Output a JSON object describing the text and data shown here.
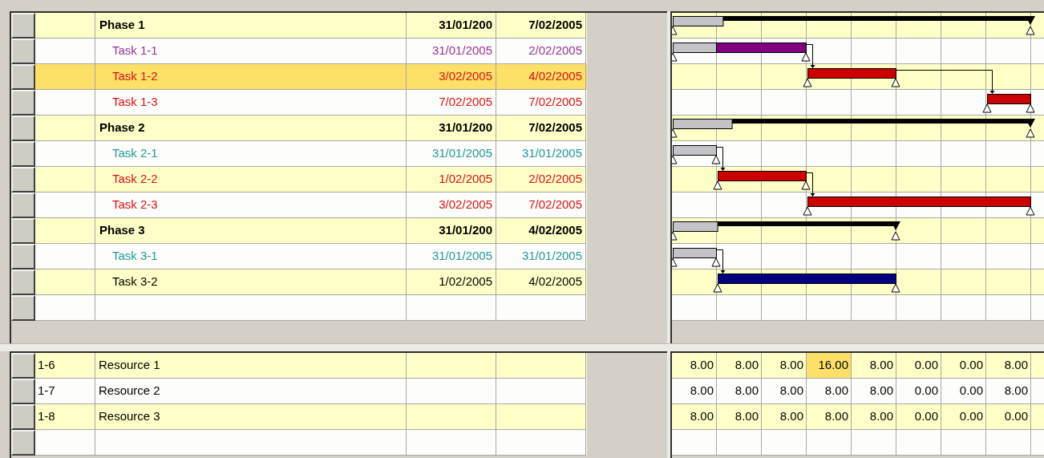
{
  "tasks": [
    {
      "kind": "phase",
      "name": "Phase 1",
      "start": "31/01/200",
      "finish": "7/02/2005",
      "selected": false,
      "level": 0.14
    },
    {
      "kind": "task",
      "name": "Task 1-1",
      "start": "31/01/2005",
      "finish": "2/02/2005",
      "color": "#993399",
      "selected": false,
      "bar": {
        "color": "#800080",
        "complete": false,
        "level": 0.33
      }
    },
    {
      "kind": "task",
      "name": "Task 1-2",
      "start": "3/02/2005",
      "finish": "4/02/2005",
      "color": "#dd1111",
      "selected": true,
      "bar": {
        "color": "#cc0000",
        "complete": false
      }
    },
    {
      "kind": "task",
      "name": "Task 1-3",
      "start": "7/02/2005",
      "finish": "7/02/2005",
      "color": "#dd1111",
      "selected": false,
      "bar": {
        "color": "#cc0000",
        "complete": false
      }
    },
    {
      "kind": "phase",
      "name": "Phase 2",
      "start": "31/01/200",
      "finish": "7/02/2005",
      "selected": false,
      "level": 0.165
    },
    {
      "kind": "task",
      "name": "Task 2-1",
      "start": "31/01/2005",
      "finish": "31/01/2005",
      "color": "#229999",
      "selected": false,
      "bar": {
        "complete": true
      }
    },
    {
      "kind": "task",
      "name": "Task 2-2",
      "start": "1/02/2005",
      "finish": "2/02/2005",
      "color": "#dd1111",
      "selected": false,
      "bar": {
        "color": "#cc0000",
        "complete": false
      }
    },
    {
      "kind": "task",
      "name": "Task 2-3",
      "start": "3/02/2005",
      "finish": "7/02/2005",
      "color": "#dd1111",
      "selected": false,
      "bar": {
        "color": "#cc0000",
        "complete": false
      }
    },
    {
      "kind": "phase",
      "name": "Phase 3",
      "start": "31/01/200",
      "finish": "4/02/2005",
      "selected": false,
      "level": 0.2
    },
    {
      "kind": "task",
      "name": "Task 3-1",
      "start": "31/01/2005",
      "finish": "31/01/2005",
      "color": "#229999",
      "selected": false,
      "bar": {
        "complete": true
      }
    },
    {
      "kind": "task",
      "name": "Task 3-2",
      "start": "1/02/2005",
      "finish": "4/02/2005",
      "color": "#000000",
      "selected": false,
      "bar": {
        "color": "#000080",
        "complete": false
      }
    }
  ],
  "resources": [
    {
      "id": "1-6",
      "name": "Resource 1",
      "hours": [
        {
          "text": "8.00",
          "highlighted": false
        },
        {
          "text": "8.00",
          "highlighted": false
        },
        {
          "text": "8.00",
          "highlighted": false
        },
        {
          "text": "16.00",
          "highlighted": true
        },
        {
          "text": "8.00",
          "highlighted": false
        },
        {
          "text": "0.00",
          "highlighted": false
        },
        {
          "text": "0.00",
          "highlighted": false
        },
        {
          "text": "8.00",
          "highlighted": false
        }
      ]
    },
    {
      "id": "1-7",
      "name": "Resource 2",
      "hours": [
        {
          "text": "8.00",
          "highlighted": false
        },
        {
          "text": "8.00",
          "highlighted": false
        },
        {
          "text": "8.00",
          "highlighted": false
        },
        {
          "text": "8.00",
          "highlighted": false
        },
        {
          "text": "8.00",
          "highlighted": false
        },
        {
          "text": "0.00",
          "highlighted": false
        },
        {
          "text": "0.00",
          "highlighted": false
        },
        {
          "text": "8.00",
          "highlighted": false
        }
      ]
    },
    {
      "id": "1-8",
      "name": "Resource 3",
      "hours": [
        {
          "text": "8.00",
          "highlighted": false
        },
        {
          "text": "8.00",
          "highlighted": false
        },
        {
          "text": "8.00",
          "highlighted": false
        },
        {
          "text": "8.00",
          "highlighted": false
        },
        {
          "text": "8.00",
          "highlighted": false
        },
        {
          "text": "0.00",
          "highlighted": false
        },
        {
          "text": "0.00",
          "highlighted": false
        },
        {
          "text": "0.00",
          "highlighted": false
        }
      ]
    }
  ]
}
